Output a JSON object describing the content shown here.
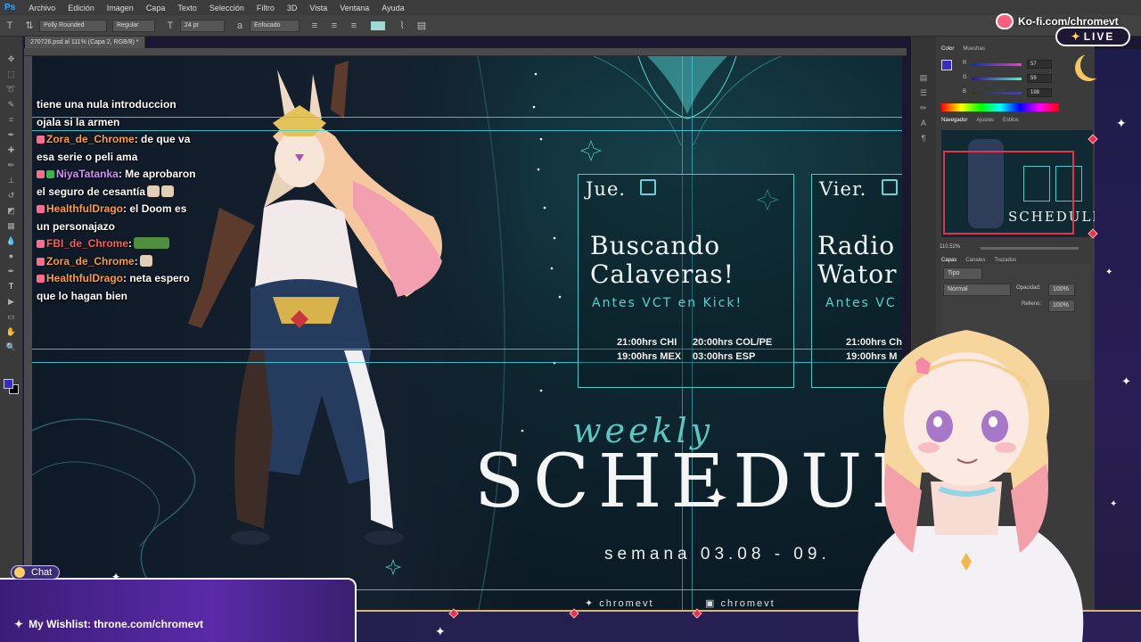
{
  "photoshop": {
    "logo": "Ps",
    "menu": [
      "Archivo",
      "Edición",
      "Imagen",
      "Capa",
      "Texto",
      "Selección",
      "Filtro",
      "3D",
      "Vista",
      "Ventana",
      "Ayuda"
    ],
    "options": {
      "font_family": "Polly Rounded",
      "font_style": "Regular",
      "font_size": "24 pt",
      "antialias": "Enfocado"
    },
    "document_tab": "270726.psd al 111% (Capa 2, RGB/8) *"
  },
  "canvas": {
    "cards": [
      {
        "day": "Jue.",
        "title": "Buscando\nCalaveras!",
        "subtitle": "Antes VCT en Kick!",
        "times": [
          "21:00hrs CHI",
          "20:00hrs COL/PE",
          "19:00hrs MEX",
          "03:00hrs ESP"
        ]
      },
      {
        "day": "Vier.",
        "title": "Radio\nWator",
        "subtitle": "Antes VC",
        "times": [
          "21:00hrs Ch",
          "19:00hrs M"
        ]
      }
    ],
    "weekly": "weekly",
    "schedule": "SCHEDUL",
    "week_range": "semana 03.08 - 09.",
    "socials": [
      "chromevt",
      "chromevt"
    ]
  },
  "chat": {
    "messages": [
      {
        "user": "",
        "text": "tiene una nula introduccion",
        "color": "#ffffff"
      },
      {
        "user": "",
        "text": "ojala si la armen",
        "color": "#ffffff"
      },
      {
        "user": "Zora_de_Chrome",
        "text": ": de que va esa serie o peli ama",
        "color": "#ff9d3c"
      },
      {
        "user": "NiyaTatanka",
        "text": ": Me aprobaron el seguro de cesantía",
        "color": "#d68cff"
      },
      {
        "user": "HealthfulDrago",
        "text": ": el Doom es un personajazo",
        "color": "#ff9d3c"
      },
      {
        "user": "FBI_de_Chrome",
        "text": ":",
        "color": "#ff5c5c"
      },
      {
        "user": "Zora_de_Chrome",
        "text": ":",
        "color": "#ff9d3c"
      },
      {
        "user": "HealthfulDrago",
        "text": ": neta espero que lo hagan bien",
        "color": "#ff9d3c"
      }
    ]
  },
  "panels": {
    "color_tabs": [
      "Color",
      "Muestras"
    ],
    "rgb": {
      "R": "57",
      "G": "59",
      "B": "198"
    },
    "nav_tabs": [
      "Navegador",
      "Ajustes",
      "Estilos"
    ],
    "zoom": "110.52%",
    "layer_tabs": [
      "Capas",
      "Canales",
      "Trazados"
    ],
    "kind_label": "Tipo",
    "blend_mode": "Normal",
    "opacity_label": "Opacidad:",
    "opacity": "100%",
    "fill_label": "Relleno:",
    "fill": "100%",
    "nav_thumb_text": "SCHEDULE"
  },
  "overlay": {
    "kofi": "Ko-fi.com/chromevt",
    "live": "LIVE",
    "chat_tag": "Chat",
    "wishlist": "My Wishlist: throne.com/chromevt"
  },
  "colors": {
    "accent_teal": "#4ec9c9",
    "foreground_color": "#3b2bc6",
    "frame_purple": "#2a1d55"
  }
}
